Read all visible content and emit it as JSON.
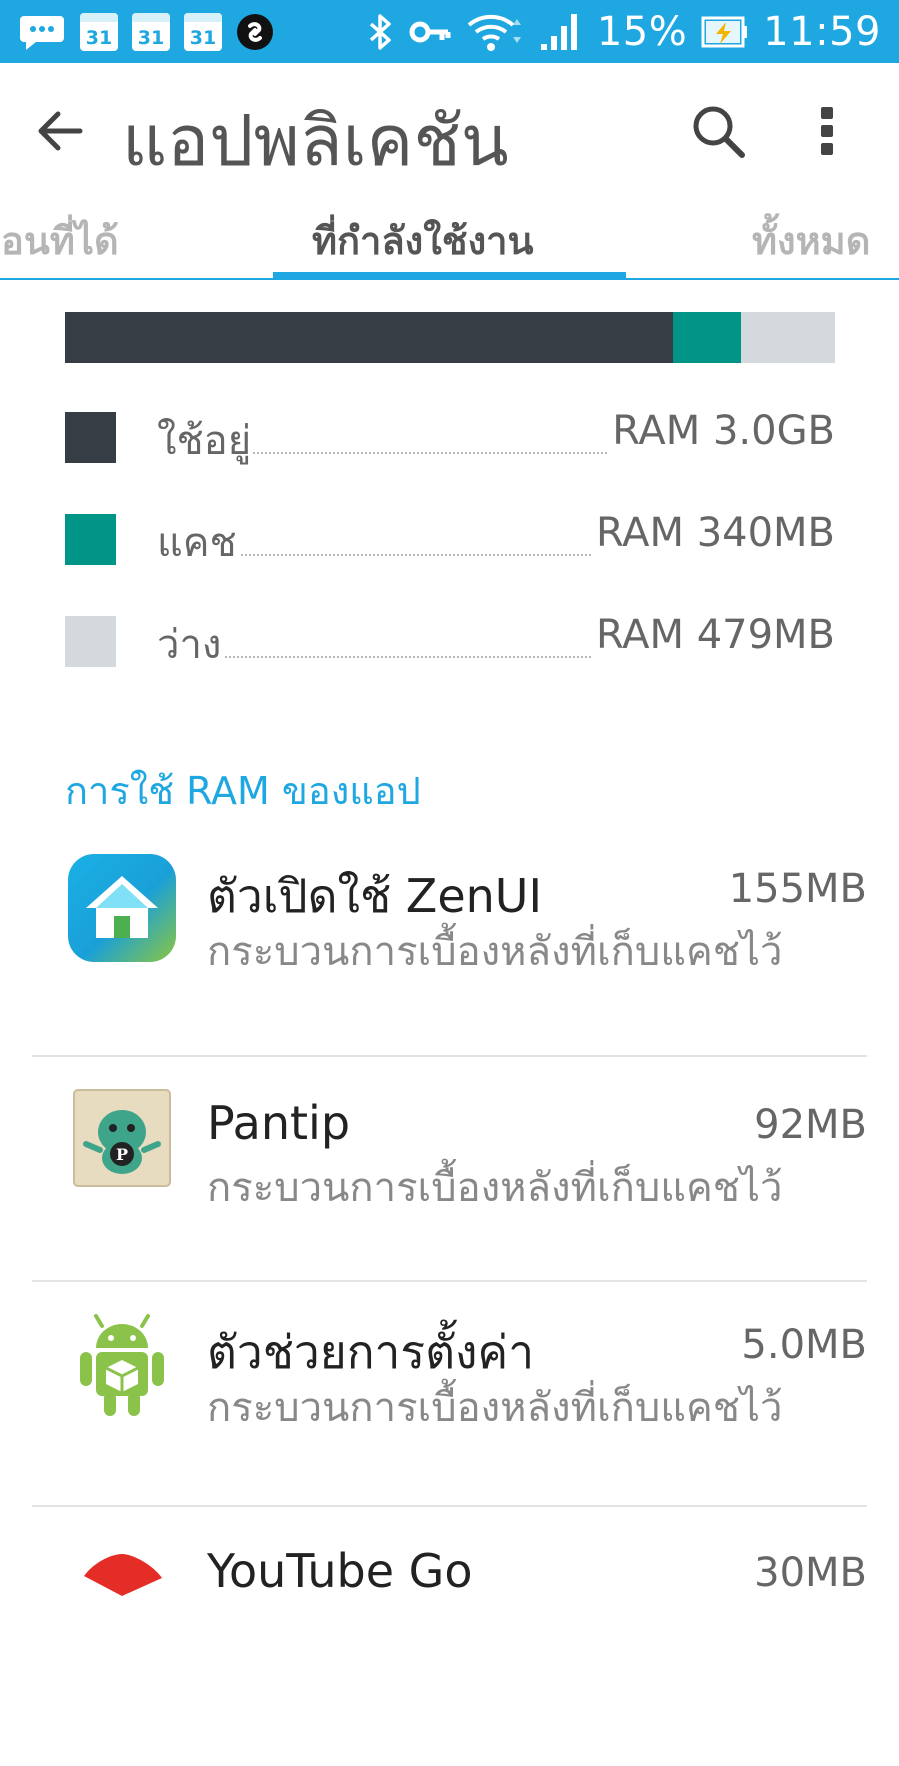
{
  "status_bar": {
    "calendar_day": "31",
    "battery_percent": "15%",
    "time": "11:59",
    "icons": [
      "message-icon",
      "calendar-icon",
      "calendar-icon",
      "calendar-icon",
      "shazam-icon",
      "bluetooth-icon",
      "vpn-key-icon",
      "wifi-icon",
      "signal-icon",
      "battery-charging-icon"
    ]
  },
  "app_bar": {
    "title": "แอปพลิเคชัน",
    "back_icon": "arrow-back-icon",
    "search_icon": "search-icon",
    "more_icon": "more-vert-icon"
  },
  "tabs": {
    "left": "ที่อนที่ได้",
    "active": "ที่กำลังใช้งาน",
    "right": "ทั้งหมด"
  },
  "ram": {
    "bar": {
      "used_fraction": 0.79,
      "cache_fraction": 0.088,
      "free_fraction": 0.122
    },
    "colors": {
      "used": "#363d45",
      "cache": "#009586",
      "free": "#d3d9dc"
    },
    "legend": [
      {
        "label": "ใช้อยู่",
        "value": "RAM 3.0GB"
      },
      {
        "label": "แคช",
        "value": "RAM 340MB"
      },
      {
        "label": "ว่าง",
        "value": "RAM 479MB"
      }
    ]
  },
  "section_title": "การใช้ RAM ของแอป",
  "apps": [
    {
      "name": "ตัวเปิดใช้ ZenUI",
      "size": "155MB",
      "status": "กระบวนการเบื้องหลังที่เก็บแคชไว้",
      "icon": "zenui-launcher-icon"
    },
    {
      "name": "Pantip",
      "size": "92MB",
      "status": "กระบวนการเบื้องหลังที่เก็บแคชไว้",
      "icon": "pantip-icon"
    },
    {
      "name": "ตัวช่วยการตั้งค่า",
      "size": "5.0MB",
      "status": "กระบวนการเบื้องหลังที่เก็บแคชไว้",
      "icon": "android-setup-icon"
    },
    {
      "name": "YouTube Go",
      "size": "30MB",
      "status": "",
      "icon": "youtube-icon"
    }
  ]
}
